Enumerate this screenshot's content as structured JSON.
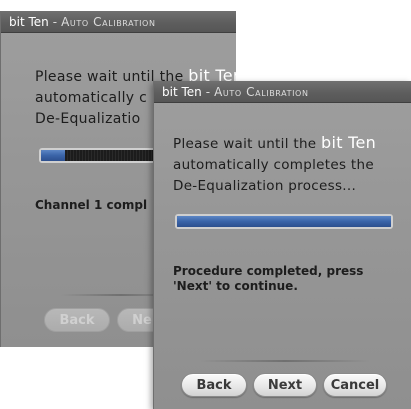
{
  "back_window": {
    "title": {
      "brand": "bit Ten",
      "separator": "-",
      "rest": "Auto Calibration"
    },
    "message": {
      "line1_a": "Please wait unt",
      "line1_b": "il the ",
      "line1_brand": "bit Ten",
      "line2": "automatically c",
      "line3": "De-Equalizatio"
    },
    "progress": {
      "fraction": 0.17
    },
    "status": "Channel 1 compl",
    "buttons": {
      "back": "Back",
      "next": "Ne"
    }
  },
  "front_window": {
    "title": {
      "brand": "bit Ten",
      "separator": "-",
      "rest": "Auto Calibration"
    },
    "message": {
      "line1": "Please wait until the ",
      "line1_brand": "bit Ten",
      "line2": "automatically completes the",
      "line3": "De-Equalization process..."
    },
    "progress": {
      "fraction": 1.0
    },
    "status": {
      "line1": "Procedure completed, press",
      "line2": "'Next' to continue."
    },
    "buttons": {
      "back": "Back",
      "next": "Next",
      "cancel": "Cancel"
    }
  },
  "colors": {
    "window_bg": "#979797",
    "titlebar_bg": "#5e5e5e",
    "progress_fill": "#3a64a8",
    "brand_text": "#ffffff"
  }
}
